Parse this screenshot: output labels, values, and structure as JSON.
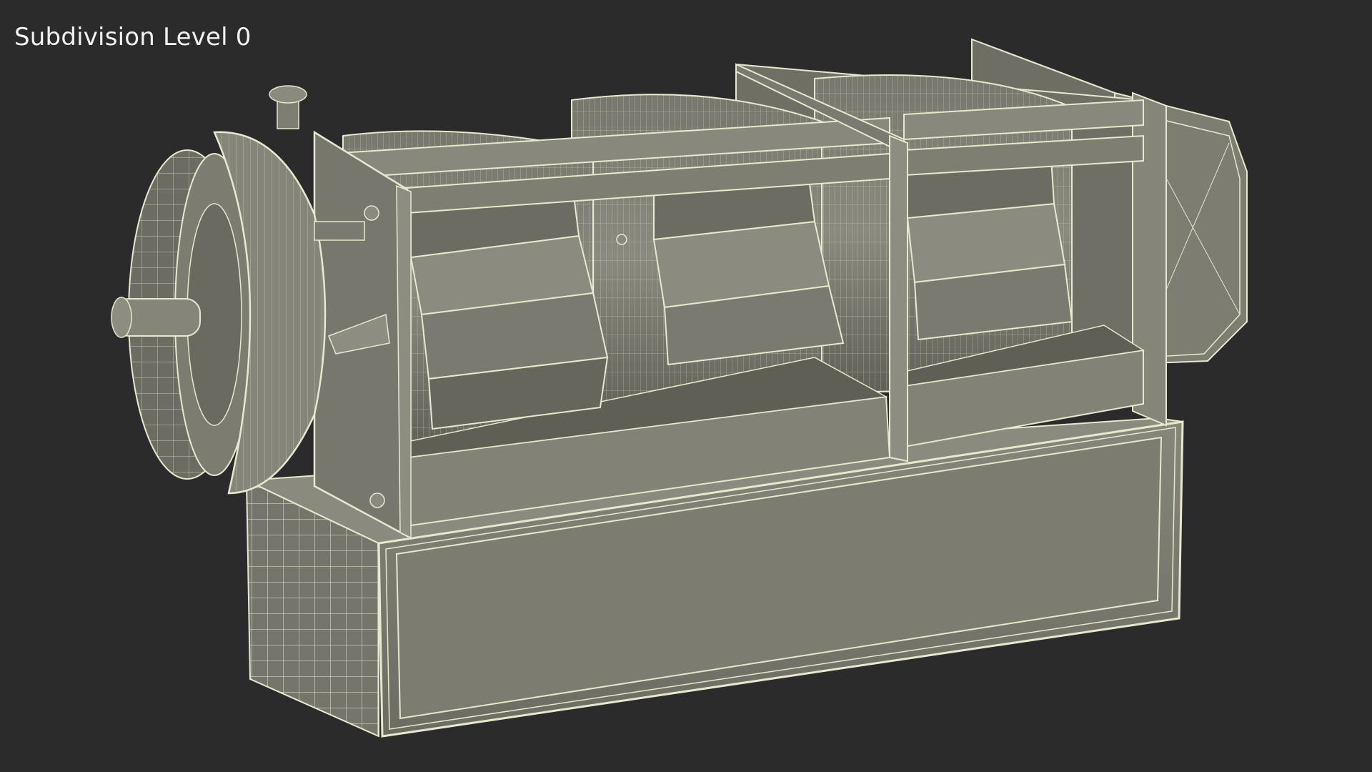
{
  "viewport": {
    "caption": "Subdivision Level 0",
    "background_color": "#2b2b2b",
    "model_fill_color": "#7e7e73",
    "wire_color": "#e8e8cf",
    "shadow_color": "#55554c"
  }
}
